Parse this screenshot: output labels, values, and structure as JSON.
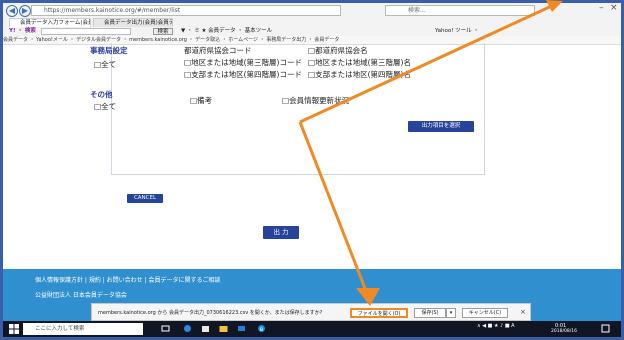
{
  "browser": {
    "address": "https://members.kainotice.org/#/member/list",
    "search_placeholder": "検索...",
    "tabs": [
      {
        "label": "会員データ入力フォーム(会員) ×"
      },
      {
        "label": "会員データ出力(会員)会員データ ×"
      }
    ],
    "toolbar_left": "Y! ・ 検索",
    "toolbar_search_btn": "検索",
    "toolbar_items": "▼ ・ ミ ★ 会員データ ・ 基本ツール",
    "toolbar_right": "Yahoo! ツール ・",
    "favorites": "会員データ ・ Yahoo!メール ・ デジタル会員データ ・ members.kainotice.org ・ データ取込 ・ ホームページ ・ 事務局データ出力 ・ 会員データ"
  },
  "page": {
    "section_office": "事務局設定",
    "section_other": "その他",
    "check_all_1": "□全て",
    "check_all_2": "□全て",
    "fields_office": [
      {
        "label": "都道府県協会コード"
      },
      {
        "label": "□都道府県協会名"
      },
      {
        "label": "□地区または地域(第三階層)コード"
      },
      {
        "label": "□地区または地域(第三階層)名"
      },
      {
        "label": "□支部または地区(第四階層)コード"
      },
      {
        "label": "□支部または地区(第四階層)名"
      }
    ],
    "field_remarks": "□備考",
    "field_status": "□会員情報更新状況",
    "select_items_button": "出力項目を選択",
    "cancel_button": "CANCEL",
    "output_button": "出 力",
    "footer_links": "個人情報保護方針 | 規約 | お問い合わせ | 会員データに関するご相談",
    "footer_org": "公益財団法人 日本会員データ協会"
  },
  "download_bar": {
    "text": "members.kainotice.org から 会員データ出力_0730616223.csv を開くか、または保存しますか?",
    "open_button": "ファイルを開く(O)",
    "save_button": "保存(S)",
    "save_arrow": "▾",
    "cancel_button": "キャンセル(C)",
    "close": "×"
  },
  "taskbar": {
    "search_placeholder": "ここに入力して検索",
    "tray": "∧ ◀ ■ ★ ♪ ■ A",
    "time": "0:01",
    "date": "2018/08/16"
  },
  "colors": {
    "frame": "#3b5ea8",
    "accent": "#27449a",
    "footer": "#2f8fcf",
    "arrow": "#f08a24",
    "taskbar": "#101624"
  }
}
